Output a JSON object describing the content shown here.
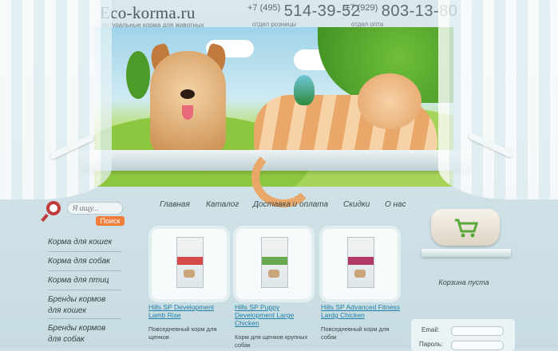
{
  "header": {
    "logo": "Eco-korma.ru",
    "tagline": "натуральные корма для животных",
    "phone_retail": {
      "code": "+7 (495)",
      "number": "514-39-52",
      "note": "отдел розницы"
    },
    "phone_wholesale": {
      "code": "+7 (929)",
      "number": "803-13-80",
      "note": "отдел опта"
    }
  },
  "search": {
    "placeholder": "Я ищу...",
    "button": "Поиск"
  },
  "nav": [
    "Главная",
    "Каталог",
    "Доставка и оплата",
    "Скидки",
    "О нас"
  ],
  "menu": [
    "Корма для кошек",
    "Корма для собак",
    "Корма для птиц",
    "Бренды кормов для кошек",
    "Бренды кормов для собак"
  ],
  "products": [
    {
      "title": "Hills SP Development Lamb Rise",
      "desc": "Повседневный корм для щенков",
      "accent": "#d64a4a"
    },
    {
      "title": "Hills SP Puppy Development Large Chicken",
      "desc": "Корм для щенков крупных собак",
      "accent": "#6aa84f"
    },
    {
      "title": "Hills SP Advanced Fitness Lardg Chicken",
      "desc": "Повседневный корм для собак",
      "accent": "#b23a6a"
    }
  ],
  "cart": {
    "status": "Корзина пуста"
  },
  "login": {
    "email_label": "Email:",
    "password_label": "Пароль:"
  },
  "colors": {
    "accent_orange": "#f07d3a",
    "link_blue": "#1f7fa8",
    "search_red": "#c03b3b"
  }
}
